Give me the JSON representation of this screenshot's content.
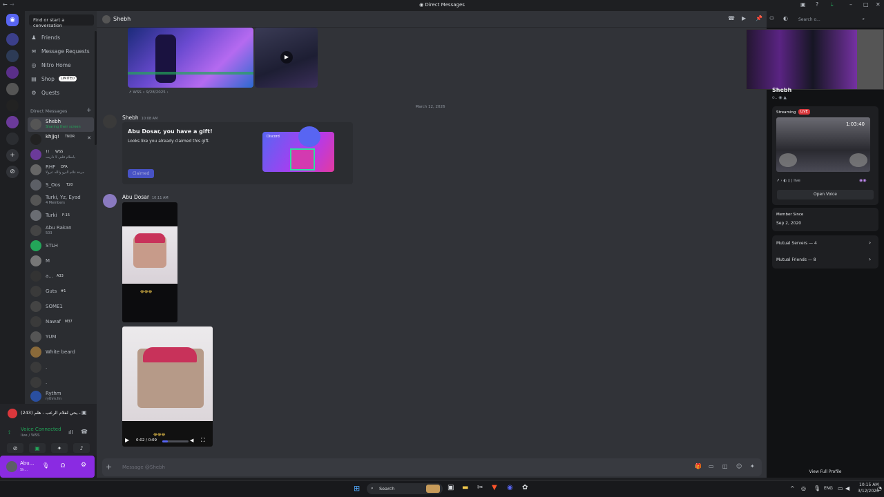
{
  "window": {
    "title": "Direct Messages"
  },
  "sidebar": {
    "search_placeholder": "Find or start a conversation",
    "nav": [
      {
        "label": "Friends",
        "icon": "friends-icon"
      },
      {
        "label": "Message Requests",
        "icon": "mail-icon"
      },
      {
        "label": "Nitro Home",
        "icon": "nitro-icon"
      },
      {
        "label": "Shop",
        "icon": "shop-icon",
        "badge": "LIMITED"
      },
      {
        "label": "Quests",
        "icon": "quests-icon"
      }
    ],
    "dm_header": "Direct Messages",
    "dms": [
      {
        "name": "Shebh",
        "sub": "Sharing their screen",
        "selected": true
      },
      {
        "name": "khjjq!",
        "tag": "TNDR"
      },
      {
        "name": "!!",
        "tag": "WSS",
        "sub": "ياسلام قلبي لا داريت"
      },
      {
        "name": "RHF",
        "tag": "DFA",
        "sub": "مردة علام البرو والله عرولا"
      },
      {
        "name": "S_Oos",
        "tag": "T20"
      },
      {
        "name": "Turki, Yz, Eyad",
        "sub": "4 Members"
      },
      {
        "name": "Turki",
        "tag": "F-15"
      },
      {
        "name": "Abu Rakan",
        "sub": "503"
      },
      {
        "name": "STLH"
      },
      {
        "name": "M"
      },
      {
        "name": "a...",
        "tag": "A33"
      },
      {
        "name": "Guts",
        "tag": "#1"
      },
      {
        "name": "SOME1"
      },
      {
        "name": "Nawaf",
        "tag": "M37"
      },
      {
        "name": "YUM"
      },
      {
        "name": "White beard"
      },
      {
        "name": "."
      },
      {
        "name": "."
      },
      {
        "name": "Rythm",
        "sub": "rythm.fm"
      }
    ],
    "now_playing": "(243) ـ يحي لفلام الرعب - هلم",
    "voice": {
      "status": "Voice Connected",
      "channel": "live / WSS"
    },
    "user": {
      "name": "Abu...",
      "status": "Sh..."
    }
  },
  "chat": {
    "recipient": "Shebh",
    "stream_caption": "WSS • 9/28/2025",
    "date_divider": "March 12, 2026",
    "messages": [
      {
        "author": "Shebh",
        "time": "10:08 AM",
        "gift_title": "Abu Dosar, you have a gift!",
        "gift_sub": "Looks like you already claimed this gift.",
        "gift_button": "Claimed",
        "gift_brand": "Discord"
      },
      {
        "author": "Abu Dosar",
        "time": "10:11 AM",
        "video_time": "0:02 / 0:09"
      }
    ],
    "composer_placeholder": "Message @Shebh",
    "header_search": "Search o..."
  },
  "profile": {
    "name": "Shebh",
    "streaming_label": "Streaming",
    "live_badge": "LIVE",
    "stream_channel": "live",
    "stream_clock": "1:03:40",
    "open_voice": "Open Voice",
    "member_since_label": "Member Since",
    "member_since": "Sep 2, 2020",
    "mutual_servers": "Mutual Servers — 4",
    "mutual_friends": "Mutual Friends — 8",
    "view_full_profile": "View Full Profile"
  },
  "taskbar": {
    "search": "Search",
    "lang": "ENG",
    "time": "10:15 AM",
    "date": "3/12/2026"
  },
  "colors": {
    "blurple": "#5865f2",
    "live_red": "#da373c",
    "user_panel": "#8a2be2",
    "green": "#23a559"
  }
}
